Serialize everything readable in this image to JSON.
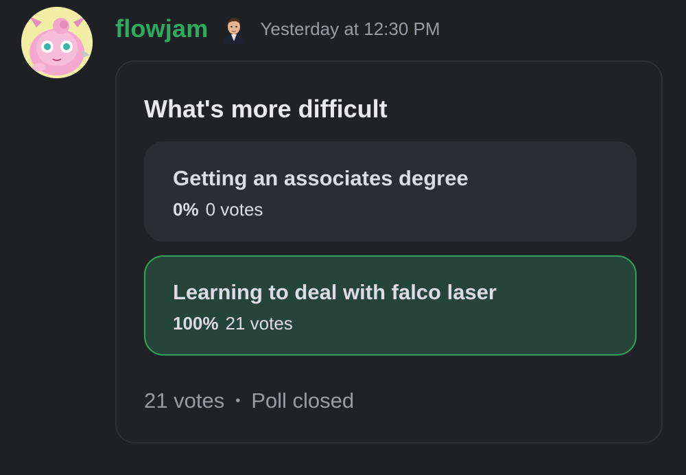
{
  "message": {
    "username": "flowjam",
    "username_color": "#2dab5f",
    "timestamp": "Yesterday at 12:30 PM",
    "avatar_icon": "pink-pokemon-avatar-icon",
    "badge_icon": "profile-badge-icon"
  },
  "poll": {
    "question": "What's more difficult",
    "answers": [
      {
        "text": "Getting an associates degree",
        "percent_label": "0%",
        "votes_label": "0 votes",
        "percent": 0,
        "winner": false
      },
      {
        "text": "Learning to deal with falco laser",
        "percent_label": "100%",
        "votes_label": "21 votes",
        "percent": 100,
        "winner": true
      }
    ],
    "total_votes": "21 votes",
    "separator": "•",
    "status": "Poll closed",
    "winner_color": "#2fa55b"
  }
}
